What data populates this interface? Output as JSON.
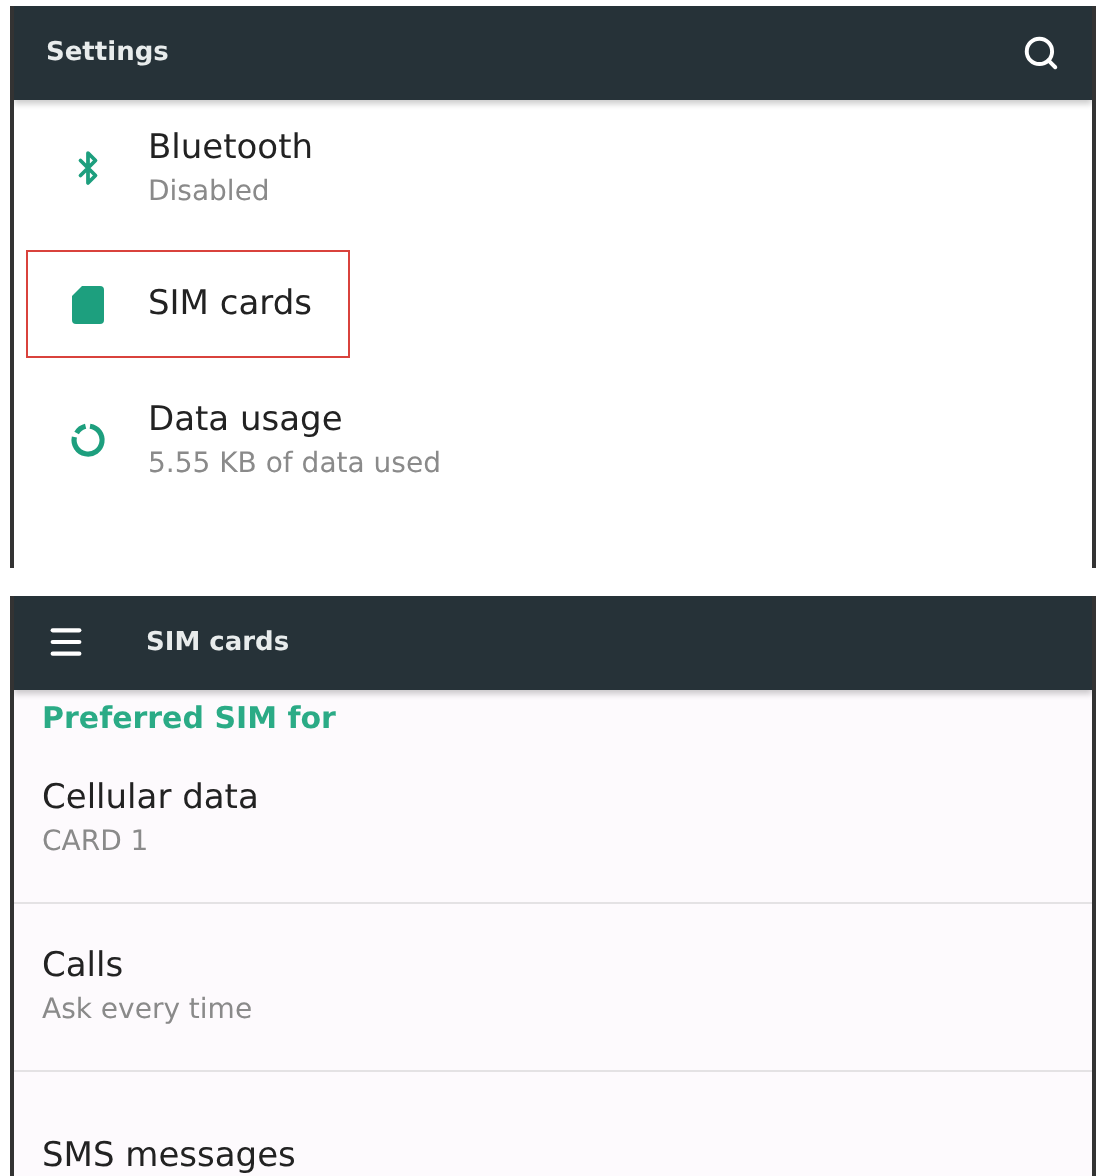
{
  "settings_screen": {
    "title": "Settings",
    "items": [
      {
        "title": "Bluetooth",
        "subtitle": "Disabled",
        "highlighted": false
      },
      {
        "title": "SIM cards",
        "highlighted": true
      },
      {
        "title": "Data usage",
        "subtitle": "5.55 KB of data used",
        "highlighted": false
      }
    ]
  },
  "sim_cards_screen": {
    "title": "SIM cards",
    "section_header": "Preferred SIM for",
    "items": [
      {
        "title": "Cellular data",
        "subtitle": "CARD 1"
      },
      {
        "title": "Calls",
        "subtitle": "Ask every time"
      },
      {
        "title": "SMS messages"
      }
    ]
  }
}
